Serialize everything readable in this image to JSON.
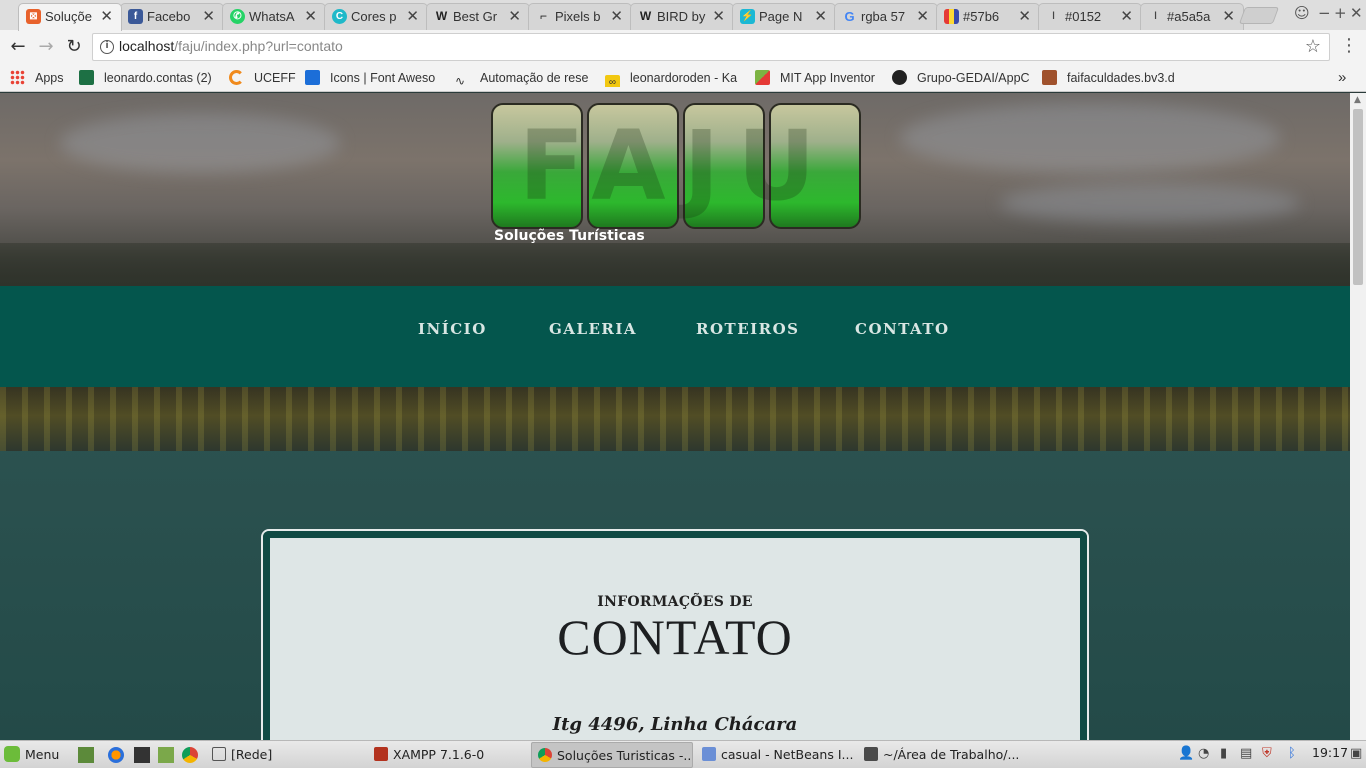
{
  "browser": {
    "tabs": [
      {
        "title": "Soluçõe",
        "favicon": "xampp",
        "color": "#e8622c",
        "active": true
      },
      {
        "title": "Facebo",
        "favicon": "f",
        "color": "#3b5998"
      },
      {
        "title": "WhatsA",
        "favicon": "w",
        "color": "#25d366"
      },
      {
        "title": "Cores p",
        "favicon": "c",
        "color": "#1fb9c9"
      },
      {
        "title": "Best Gr",
        "favicon": "W",
        "color": "#333333"
      },
      {
        "title": "Pixels b",
        "favicon": "px",
        "color": "#222222"
      },
      {
        "title": "BIRD by",
        "favicon": "W",
        "color": "#333333"
      },
      {
        "title": "Page N",
        "favicon": "bolt",
        "color": "#1bb8d4"
      },
      {
        "title": "rgba 57",
        "favicon": "G",
        "color": "#4285f4"
      },
      {
        "title": "#57b6",
        "favicon": "bars",
        "color": "#c43ad6"
      },
      {
        "title": "#0152",
        "favicon": "pin",
        "color": "#555555"
      },
      {
        "title": "#a5a5a",
        "favicon": "pin",
        "color": "#555555"
      }
    ],
    "close_symbol": "✕",
    "url_host": "localhost",
    "url_path": "/faju/index.php?url=contato",
    "bookmarks": [
      {
        "label": "Apps",
        "icon": "apps-grid-icon",
        "color": "#e94235"
      },
      {
        "label": "leonardo.contas (2)",
        "icon": "excel-icon",
        "color": "#1d7044"
      },
      {
        "label": "UCEFF",
        "icon": "uceff-icon",
        "color": "#f08a1c"
      },
      {
        "label": "Icons | Font Aweso",
        "icon": "flag-icon",
        "color": "#1c6ed8"
      },
      {
        "label": "Automação de rese",
        "icon": "wave-icon",
        "color": "#333333"
      },
      {
        "label": "leonardoroden - Ka",
        "icon": "infinity-icon",
        "color": "#f2c811"
      },
      {
        "label": "MIT App Inventor",
        "icon": "appinventor-icon",
        "color": "#7cb342"
      },
      {
        "label": "Grupo-GEDAI/AppC",
        "icon": "github-icon",
        "color": "#222222"
      },
      {
        "label": "faifaculdades.bv3.d",
        "icon": "arrow-icon",
        "color": "#a0522d"
      }
    ],
    "overflow_symbol": "»"
  },
  "site": {
    "logo_text": "FAJU",
    "logo_subtitle": "Soluções Turísticas",
    "nav": [
      "INÍCIO",
      "GALERIA",
      "ROTEIROS",
      "CONTATO"
    ],
    "contact": {
      "kicker": "INFORMAÇÕES DE",
      "title": "CONTATO",
      "address": "Itg 4496, Linha Chácara"
    }
  },
  "taskbar": {
    "menu_label": "Menu",
    "tasks": [
      {
        "label": "[Rede]",
        "icon": "network-icon"
      },
      {
        "label": "XAMPP 7.1.6-0",
        "icon": "xampp-icon"
      },
      {
        "label": "Soluções Turisticas -...",
        "icon": "chrome-icon",
        "active": true
      },
      {
        "label": "casual - NetBeans I...",
        "icon": "netbeans-icon"
      },
      {
        "label": "~/Área de Trabalho/...",
        "icon": "sublime-icon"
      }
    ],
    "clock": "19:17"
  },
  "colors": {
    "nav_band": "#04564d",
    "card_border": "#0f4a44",
    "active_tab": "#f3f3f3"
  }
}
